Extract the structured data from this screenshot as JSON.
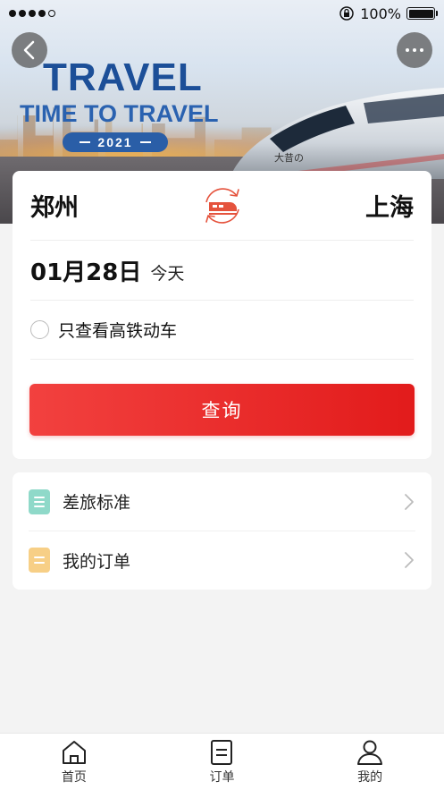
{
  "status_bar": {
    "battery_text": "100%",
    "signal_bars_filled": 4,
    "signal_bars_total": 5
  },
  "banner": {
    "title": "TRAVEL",
    "subtitle": "TIME TO TRAVEL",
    "year": "2021",
    "train_text": "大昔の"
  },
  "route": {
    "from_city": "郑州",
    "to_city": "上海"
  },
  "date": {
    "value": "01月28日",
    "label": "今天"
  },
  "filter": {
    "label": "只查看高铁动车",
    "checked": false
  },
  "query_button": "查询",
  "menu": {
    "items": [
      {
        "label": "差旅标准",
        "icon": "document-icon",
        "color": "#8fd9c9"
      },
      {
        "label": "我的订单",
        "icon": "order-icon",
        "color": "#f7cf86"
      }
    ]
  },
  "tabs": [
    {
      "label": "首页",
      "icon": "home-icon"
    },
    {
      "label": "订单",
      "icon": "order-list-icon"
    },
    {
      "label": "我的",
      "icon": "user-icon"
    }
  ],
  "colors": {
    "accent_red": "#e21b1b",
    "banner_blue": "#1c4f98"
  }
}
